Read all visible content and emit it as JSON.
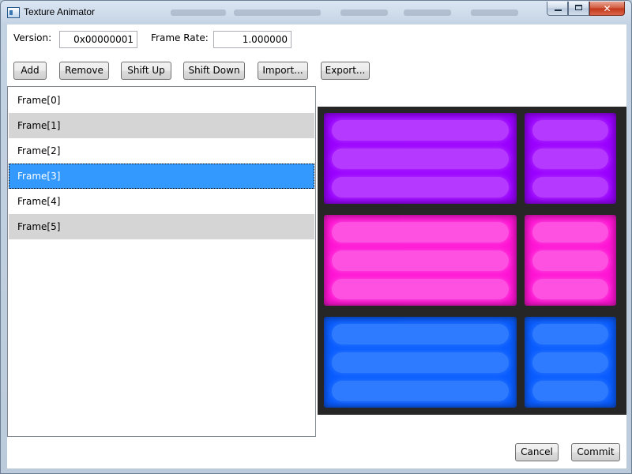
{
  "window": {
    "title": "Texture Animator",
    "controls": {
      "minimize": "minimize",
      "maximize": "maximize",
      "close": "close"
    }
  },
  "settings": {
    "version_label": "Version:",
    "version_value": "0x00000001",
    "frame_rate_label": "Frame Rate:",
    "frame_rate_value": "1.000000"
  },
  "toolbar": {
    "add": "Add",
    "remove": "Remove",
    "shift_up": "Shift Up",
    "shift_down": "Shift Down",
    "import": "Import...",
    "export": "Export..."
  },
  "frames": {
    "items": [
      "Frame[0]",
      "Frame[1]",
      "Frame[2]",
      "Frame[3]",
      "Frame[4]",
      "Frame[5]"
    ],
    "selected_index": 3
  },
  "texture_preview": {
    "background": "#262626",
    "rows": [
      {
        "color": "#9900ff",
        "glow": "#c04dff"
      },
      {
        "color": "#ff14d4",
        "glow": "#ff66e6"
      },
      {
        "color": "#0a5cff",
        "glow": "#3b86ff"
      }
    ]
  },
  "footer": {
    "cancel": "Cancel",
    "commit": "Commit"
  }
}
